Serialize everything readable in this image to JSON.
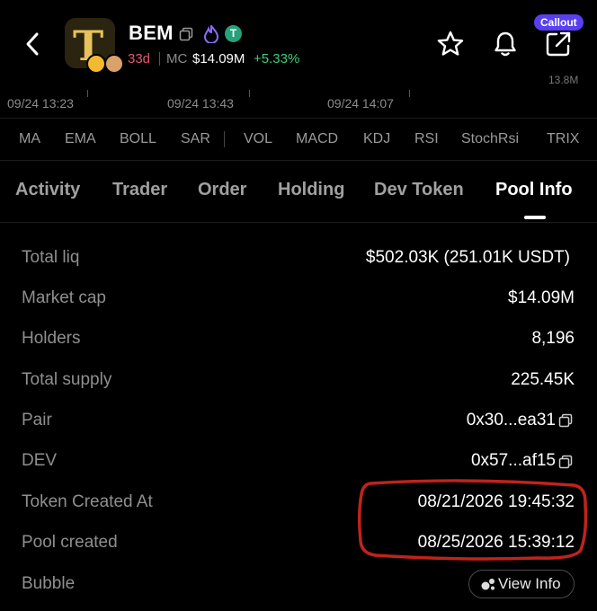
{
  "header": {
    "token_symbol": "BEM",
    "age": "33d",
    "mc_label": "MC",
    "market_cap": "$14.09M",
    "change": "+5.33%",
    "callout_label": "Callout",
    "icons": [
      "back-arrow-icon",
      "token-logo",
      "copy-icon",
      "fire-icon",
      "tether-icon",
      "star-icon",
      "bell-icon",
      "share-icon"
    ]
  },
  "chart_strip": {
    "volume_tail": "13.8M",
    "times": [
      "09/24 13:23",
      "09/24 13:43",
      "09/24 14:07"
    ]
  },
  "indicators": [
    "MA",
    "EMA",
    "BOLL",
    "SAR",
    "VOL",
    "MACD",
    "KDJ",
    "RSI",
    "StochRsi",
    "TRIX"
  ],
  "tabs": [
    "Activity",
    "Trader",
    "Order",
    "Holding",
    "Dev Token",
    "Pool Info"
  ],
  "active_tab": "Pool Info",
  "pool_info": [
    {
      "label": "Total liq",
      "value": "$502.03K (251.01K USDT)"
    },
    {
      "label": "Market cap",
      "value": "$14.09M"
    },
    {
      "label": "Holders",
      "value": "8,196"
    },
    {
      "label": "Total supply",
      "value": "225.45K"
    },
    {
      "label": "Pair",
      "value": "0x30...ea31"
    },
    {
      "label": "DEV",
      "value": "0x57...af15"
    },
    {
      "label": "Token Created At",
      "value": "08/21/2026 19:45:32"
    },
    {
      "label": "Pool created",
      "value": "08/25/2026 15:39:12"
    },
    {
      "label": "Bubble",
      "value": "View Info"
    }
  ],
  "colors": {
    "background": "#000000",
    "positive": "#3fcf7a",
    "age": "#e25a6e",
    "callout": "#5a3ff0",
    "annotation": "#c0231b"
  }
}
